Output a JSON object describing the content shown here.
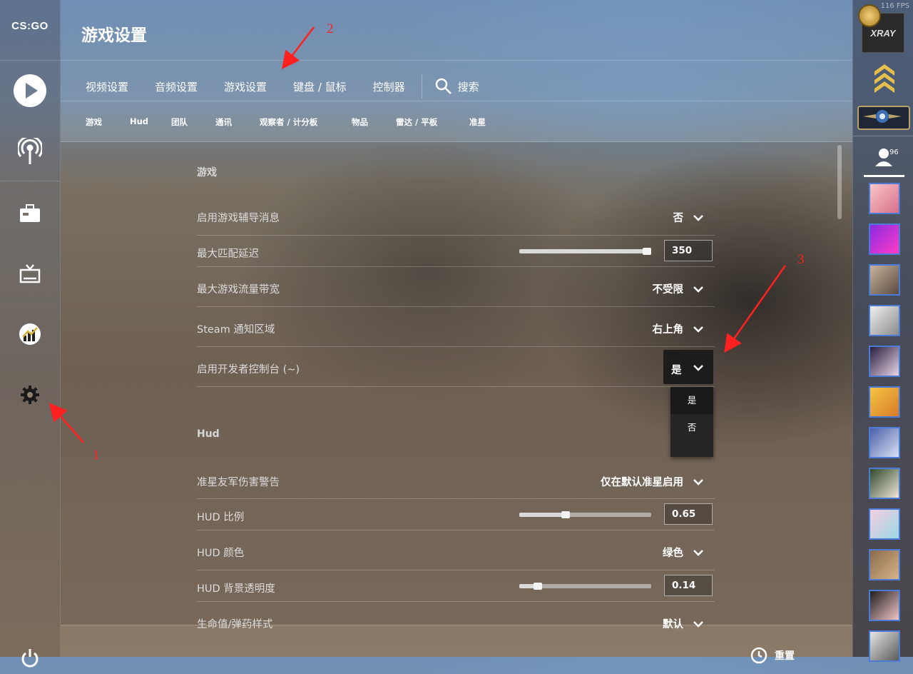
{
  "app": {
    "logo_text": "CS:GO",
    "fps_text": "116 FPS"
  },
  "header": {
    "title": "游戏设置"
  },
  "tabs": [
    {
      "label": "视频设置"
    },
    {
      "label": "音频设置"
    },
    {
      "label": "游戏设置"
    },
    {
      "label": "键盘 / 鼠标"
    },
    {
      "label": "控制器"
    }
  ],
  "search": {
    "label": "搜索"
  },
  "subtabs": [
    {
      "label": "游戏"
    },
    {
      "label": "Hud"
    },
    {
      "label": "团队"
    },
    {
      "label": "通讯"
    },
    {
      "label": "观察者 / 计分板"
    },
    {
      "label": "物品"
    },
    {
      "label": "雷达 / 平板"
    },
    {
      "label": "准星"
    }
  ],
  "sections": {
    "game": {
      "title": "游戏",
      "rows": [
        {
          "label": "启用游戏辅导消息",
          "value": "否"
        },
        {
          "label": "最大匹配延迟",
          "value": "350",
          "level": 0.97
        },
        {
          "label": "最大游戏流量带宽",
          "value": "不受限"
        },
        {
          "label": "Steam 通知区域",
          "value": "右上角"
        },
        {
          "label": "启用开发者控制台 (~)",
          "value": "是"
        }
      ]
    },
    "hud": {
      "title": "Hud",
      "rows": [
        {
          "label": "准星友军伤害警告",
          "value": "仅在默认准星启用"
        },
        {
          "label": "HUD 比例",
          "value": "0.65",
          "level": 0.35
        },
        {
          "label": "HUD 颜色",
          "value": "绿色"
        },
        {
          "label": "HUD 背景透明度",
          "value": "0.14",
          "level": 0.14
        },
        {
          "label": "生命值/弹药样式",
          "value": "默认"
        }
      ]
    }
  },
  "dropdown": {
    "options": [
      "是",
      "否"
    ],
    "selected": "是"
  },
  "footer": {
    "reset_label": "重置"
  },
  "friends": {
    "count": "96"
  },
  "annotations": {
    "a1": "1",
    "a2": "2",
    "a3": "3"
  },
  "colors": {
    "annotation": "#ff2020",
    "avatar_border": "#4b7bd6"
  }
}
